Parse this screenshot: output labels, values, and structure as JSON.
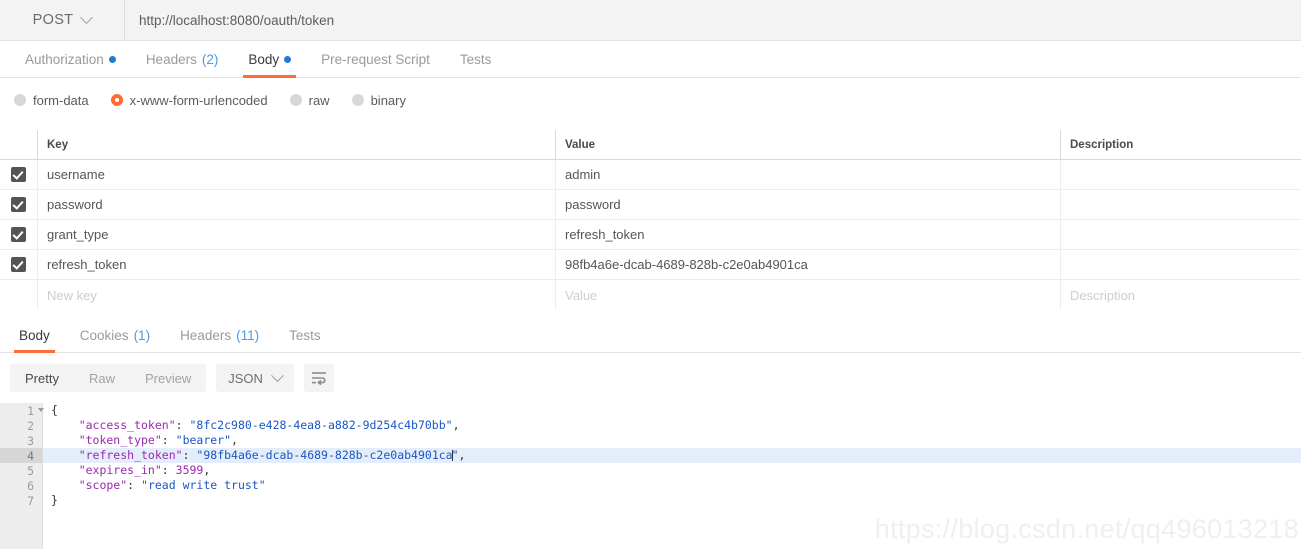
{
  "request": {
    "method": "POST",
    "url": "http://localhost:8080/oauth/token",
    "tabs": [
      {
        "label": "Authorization",
        "badge": "",
        "dot": true,
        "active": false
      },
      {
        "label": "Headers",
        "badge": "(2)",
        "dot": false,
        "active": false
      },
      {
        "label": "Body",
        "badge": "",
        "dot": true,
        "active": true
      },
      {
        "label": "Pre-request Script",
        "badge": "",
        "dot": false,
        "active": false
      },
      {
        "label": "Tests",
        "badge": "",
        "dot": false,
        "active": false
      }
    ],
    "body_types": [
      {
        "label": "form-data",
        "selected": false
      },
      {
        "label": "x-www-form-urlencoded",
        "selected": true
      },
      {
        "label": "raw",
        "selected": false
      },
      {
        "label": "binary",
        "selected": false
      }
    ],
    "table": {
      "headers": {
        "key": "Key",
        "value": "Value",
        "description": "Description"
      },
      "rows": [
        {
          "checked": true,
          "key": "username",
          "value": "admin",
          "description": ""
        },
        {
          "checked": true,
          "key": "password",
          "value": "password",
          "description": ""
        },
        {
          "checked": true,
          "key": "grant_type",
          "value": "refresh_token",
          "description": ""
        },
        {
          "checked": true,
          "key": "refresh_token",
          "value": "98fb4a6e-dcab-4689-828b-c2e0ab4901ca",
          "description": ""
        }
      ],
      "new_row": {
        "key_placeholder": "New key",
        "value_placeholder": "Value",
        "description_placeholder": "Description"
      }
    }
  },
  "response": {
    "tabs": [
      {
        "label": "Body",
        "badge": "",
        "active": true
      },
      {
        "label": "Cookies",
        "badge": "(1)",
        "active": false
      },
      {
        "label": "Headers",
        "badge": "(11)",
        "active": false
      },
      {
        "label": "Tests",
        "badge": "",
        "active": false
      }
    ],
    "view_modes": [
      {
        "label": "Pretty",
        "active": true
      },
      {
        "label": "Raw",
        "active": false
      },
      {
        "label": "Preview",
        "active": false
      }
    ],
    "format": "JSON",
    "wrap_icon": "word-wrap-icon",
    "body": {
      "highlighted_line": 4,
      "lines": [
        {
          "num": "1",
          "foldable": true,
          "indent": 0,
          "tokens": [
            {
              "t": "{",
              "c": "p"
            }
          ]
        },
        {
          "num": "2",
          "foldable": false,
          "indent": 1,
          "tokens": [
            {
              "t": "\"access_token\"",
              "c": "k"
            },
            {
              "t": ": ",
              "c": "p"
            },
            {
              "t": "\"8fc2c980-e428-4ea8-a882-9d254c4b70bb\"",
              "c": "s"
            },
            {
              "t": ",",
              "c": "p"
            }
          ]
        },
        {
          "num": "3",
          "foldable": false,
          "indent": 1,
          "tokens": [
            {
              "t": "\"token_type\"",
              "c": "k"
            },
            {
              "t": ": ",
              "c": "p"
            },
            {
              "t": "\"bearer\"",
              "c": "s"
            },
            {
              "t": ",",
              "c": "p"
            }
          ]
        },
        {
          "num": "4",
          "foldable": false,
          "indent": 1,
          "tokens": [
            {
              "t": "\"refresh_token\"",
              "c": "k"
            },
            {
              "t": ": ",
              "c": "p"
            },
            {
              "t": "\"98fb4a6e-dcab-4689-828b-c2e0ab4901ca",
              "c": "s"
            },
            {
              "t": "|caret|",
              "c": "caret"
            },
            {
              "t": "\"",
              "c": "s"
            },
            {
              "t": ",",
              "c": "p"
            }
          ]
        },
        {
          "num": "5",
          "foldable": false,
          "indent": 1,
          "tokens": [
            {
              "t": "\"expires_in\"",
              "c": "k"
            },
            {
              "t": ": ",
              "c": "p"
            },
            {
              "t": "3599",
              "c": "n"
            },
            {
              "t": ",",
              "c": "p"
            }
          ]
        },
        {
          "num": "6",
          "foldable": false,
          "indent": 1,
          "tokens": [
            {
              "t": "\"scope\"",
              "c": "k"
            },
            {
              "t": ": ",
              "c": "p"
            },
            {
              "t": "\"read write trust\"",
              "c": "s"
            }
          ]
        },
        {
          "num": "7",
          "foldable": false,
          "indent": 0,
          "tokens": [
            {
              "t": "}",
              "c": "p"
            }
          ]
        }
      ]
    }
  },
  "watermark": "https://blog.csdn.net/qq496013218",
  "colors": {
    "accent": "#ff6c37",
    "badge_blue": "#4f9ae0",
    "dot_blue": "#1c7cd6",
    "string": "#1a56c4",
    "key": "#9c27b0",
    "highlight_line": "#e4eefb"
  }
}
